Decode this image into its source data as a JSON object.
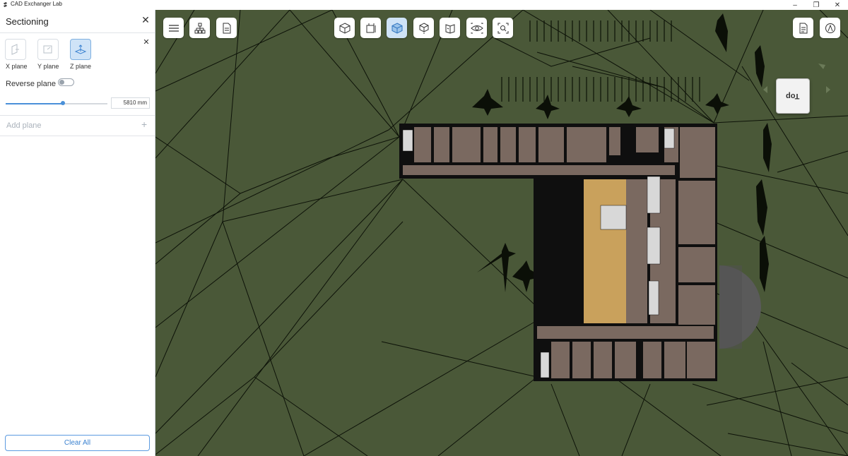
{
  "app": {
    "title": "CAD Exchanger Lab"
  },
  "window_controls": {
    "minimize": "–",
    "restore": "❐",
    "close": "✕"
  },
  "panel": {
    "title": "Sectioning",
    "close_symbol": "✕",
    "planes": [
      {
        "label": "X plane",
        "active": false
      },
      {
        "label": "Y plane",
        "active": false
      },
      {
        "label": "Z plane",
        "active": true
      }
    ],
    "reverse_plane_label": "Reverse plane",
    "reverse_plane_on": false,
    "slider_value": "5810 mm",
    "slider_fraction": 0.56,
    "add_plane_label": "Add plane",
    "add_plane_symbol": "+",
    "clear_all_label": "Clear All"
  },
  "viewport": {
    "background_color": "#4a5838",
    "navcube_label": "Top",
    "toolbar_left": [
      "menu-icon",
      "structure-tree-icon",
      "properties-icon"
    ],
    "toolbar_center": [
      "shaded-view-icon",
      "sectioning-icon",
      "display-mode-icon",
      "explode-icon",
      "measure-icon",
      "visibility-icon",
      "fit-all-icon"
    ],
    "toolbar_right": [
      "document-icon",
      "profile-icon"
    ],
    "active_tool": "display-mode-icon"
  }
}
